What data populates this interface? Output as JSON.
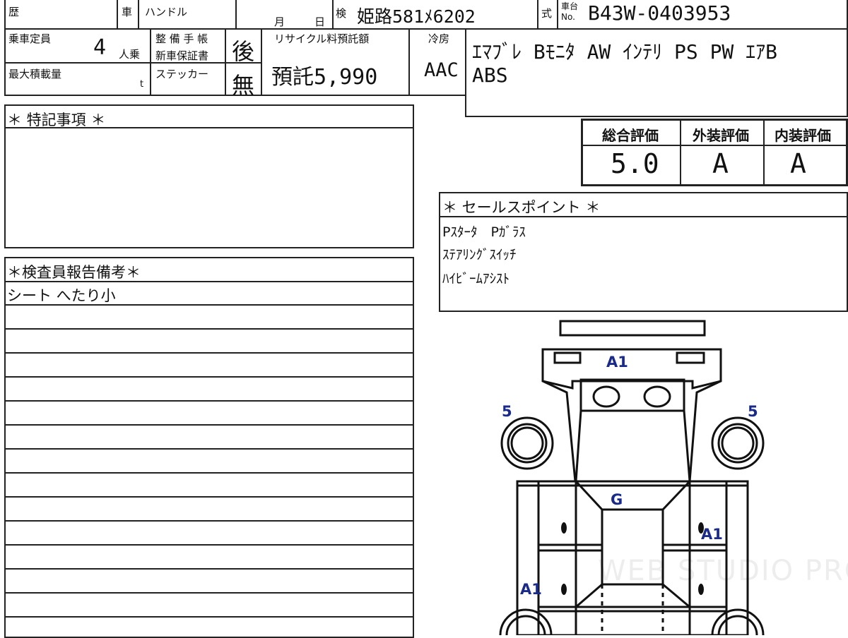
{
  "header": {
    "history_label": "歴",
    "car_label": "車",
    "handle_label": "ハンドル",
    "month_label": "月",
    "day_label": "日",
    "inspection_label": "検",
    "plate": "姫路581ﾒ6202",
    "type_label": "式",
    "chassis_label_1": "車台",
    "chassis_label_2": "No.",
    "chassis_no": "B43W-0403953"
  },
  "info": {
    "capacity_label": "乗車定員",
    "capacity_value": "4",
    "capacity_unit": "人乗",
    "maint_label_1": "整 備 手 帳",
    "maint_label_2": "新車保証書",
    "maint_value": "後",
    "recycle_label": "リサイクル料預託額",
    "recycle_value": "預託5,990",
    "ac_label": "冷房",
    "ac_value": "AAC",
    "maxload_label": "最大積載量",
    "maxload_unit": "t",
    "sticker_label": "ステッカー",
    "sticker_value": "無"
  },
  "equipment": {
    "line1": "ｴﾏﾌﾞﾚ Bﾓﾆﾀ AW ｲﾝﾃﾘ PS PW ｴｱB",
    "line2": "ABS"
  },
  "ratings": {
    "overall_label": "総合評価",
    "exterior_label": "外装評価",
    "interior_label": "内装評価",
    "overall_value": "5.0",
    "exterior_value": "A",
    "interior_value": "A"
  },
  "special_notes": {
    "title": "＊ 特記事項 ＊"
  },
  "sales_points": {
    "title": "＊ セールスポイント ＊",
    "lines": [
      "Pｽﾀｰﾀ　Pｶﾞﾗｽ",
      "ｽﾃｱﾘﾝｸﾞｽｲｯﾁ",
      "ﾊｲﾋﾞｰﾑｱｼｽﾄ"
    ]
  },
  "inspector": {
    "title": "＊検査員報告備考＊",
    "first_line": "シート へたり小"
  },
  "diagram": {
    "marks": {
      "front": "A1",
      "left_front_tire": "5",
      "right_front_tire": "5",
      "roof": "G",
      "right_door": "A1",
      "left_rear": "A1"
    }
  },
  "watermark": "WEB STUDIO PRO"
}
